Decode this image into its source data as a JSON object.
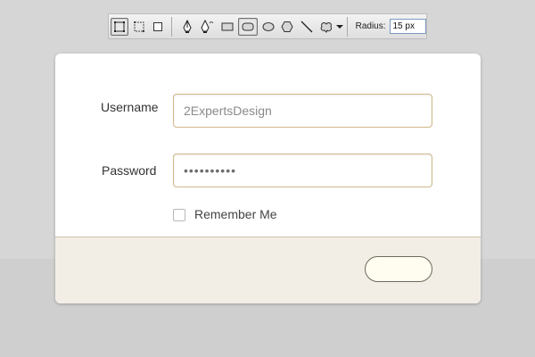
{
  "toolbar": {
    "tools": [
      {
        "name": "shape-layers-mode-icon",
        "active": true
      },
      {
        "name": "paths-mode-icon",
        "active": false
      },
      {
        "name": "fill-pixels-mode-icon",
        "active": false
      },
      {
        "name": "pen-tool-icon",
        "active": false
      },
      {
        "name": "freeform-pen-tool-icon",
        "active": false
      },
      {
        "name": "rectangle-tool-icon",
        "active": false
      },
      {
        "name": "rounded-rectangle-tool-icon",
        "active": true
      },
      {
        "name": "ellipse-tool-icon",
        "active": false
      },
      {
        "name": "polygon-tool-icon",
        "active": false
      },
      {
        "name": "line-tool-icon",
        "active": false
      },
      {
        "name": "custom-shape-tool-icon",
        "active": false
      }
    ],
    "radius_label": "Radius:",
    "radius_value": "15 px"
  },
  "form": {
    "username_label": "Username",
    "username_value": "2ExpertsDesign",
    "password_label": "Password",
    "password_value": "••••••••••",
    "remember_label": "Remember Me",
    "remember_checked": false
  },
  "colors": {
    "field_border": "#cfb88a",
    "footer_bg": "#f2eee6",
    "button_fill": "#fffdf0"
  }
}
